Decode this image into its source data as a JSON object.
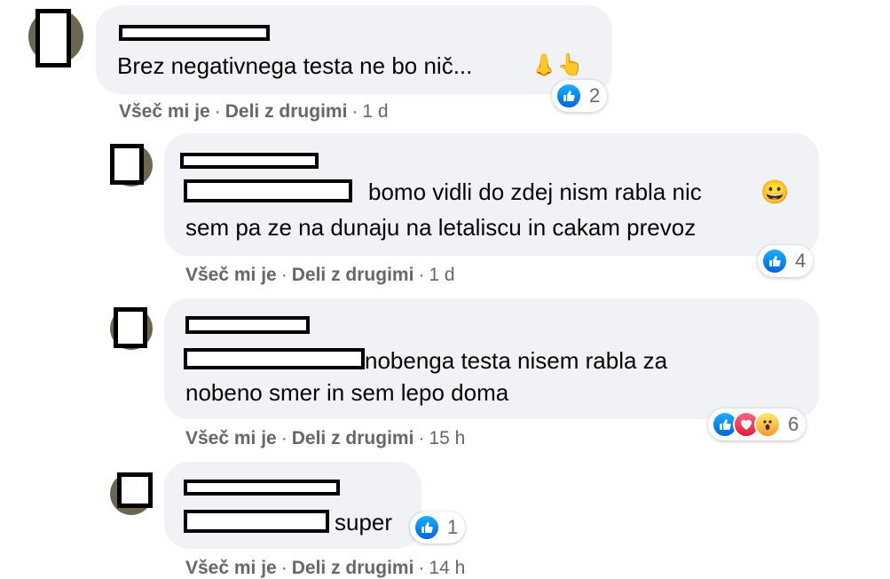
{
  "comments": [
    {
      "text_lines": [
        "Brez negativnega testa ne bo nič...",
        ""
      ],
      "emoji": "👃👆",
      "reaction_count": "2",
      "reactions": [
        "like"
      ],
      "like": "Všeč mi je",
      "share": "Deli z drugimi",
      "time": "1 d"
    },
    {
      "text_lines": [
        "bomo vidli do zdej nism rabla nic",
        "sem pa ze na dunaju na letaliscu in cakam prevoz"
      ],
      "emoji": "😀",
      "reaction_count": "4",
      "reactions": [
        "like"
      ],
      "like": "Všeč mi je",
      "share": "Deli z drugimi",
      "time": "1 d"
    },
    {
      "text_lines": [
        "nobenga testa nisem rabla za",
        "nobeno smer in sem lepo doma"
      ],
      "reaction_count": "6",
      "reactions": [
        "like",
        "love",
        "wow"
      ],
      "like": "Všeč mi je",
      "share": "Deli z drugimi",
      "time": "15 h"
    },
    {
      "text_lines": [
        "super"
      ],
      "reaction_count": "1",
      "reactions": [
        "like"
      ],
      "like": "Všeč mi je",
      "share": "Deli z drugimi",
      "time": "14 h"
    }
  ],
  "dot": "·",
  "icons": {
    "like": "thumbs-up-icon",
    "love": "heart-icon",
    "wow": "wow-face-icon"
  },
  "colors": {
    "bubble": "#f0f2f5",
    "meta": "#65676b",
    "like_blue": "#1877f2"
  }
}
